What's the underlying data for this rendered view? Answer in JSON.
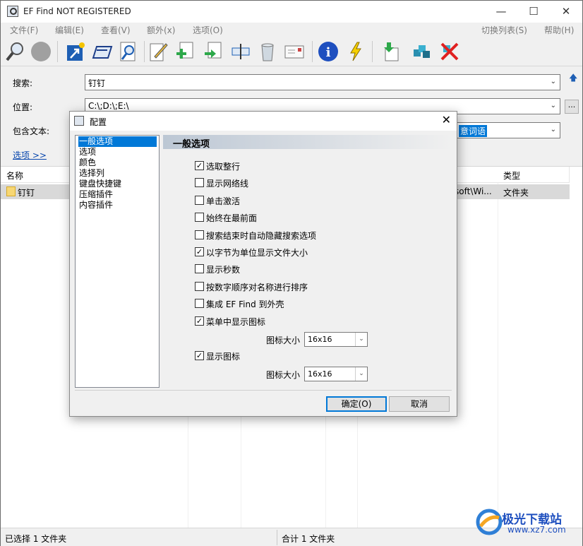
{
  "app": {
    "title": "EF Find NOT REGISTERED",
    "window_controls": {
      "minimize": "—",
      "maximize": "☐",
      "close": "✕"
    }
  },
  "menu": {
    "left": [
      "文件(F)",
      "编辑(E)",
      "查看(V)",
      "额外(x)",
      "选项(O)"
    ],
    "right": [
      "切换列表(S)",
      "帮助(H)"
    ]
  },
  "toolbar": {
    "icons": [
      "search-icon",
      "stop-icon",
      "open-folder-icon",
      "open-window-icon",
      "search-in-icon",
      "edit-icon",
      "copy-to-icon",
      "move-to-icon",
      "rename-icon",
      "recycle-bin-icon",
      "email-icon",
      "info-icon",
      "lightning-icon",
      "download-icon",
      "extract-icon",
      "delete-icon"
    ]
  },
  "search": {
    "search_label": "搜索:",
    "search_value": "钉钉",
    "location_label": "位置:",
    "location_value": "C:\\;D:\\;E:\\",
    "contains_label": "包含文本:",
    "contains_highlight": "意词语",
    "options_link": "选项 >>",
    "browse_label": "..."
  },
  "list": {
    "columns": [
      "名称",
      "类型"
    ],
    "rows": [
      {
        "name": "钉钉",
        "path_fragment": "soft\\Wi...",
        "type": "文件夹"
      }
    ]
  },
  "status": {
    "selected": "已选择 1 文件夹",
    "total": "合计 1 文件夹"
  },
  "dialog": {
    "title": "配置",
    "close": "✕",
    "tree": [
      "一般选项",
      "选项",
      "颜色",
      "选择列",
      "键盘快捷键",
      "压缩插件",
      "内容插件"
    ],
    "selected_tree_index": 0,
    "section_title": "一般选项",
    "options": [
      {
        "label": "选取整行",
        "checked": true
      },
      {
        "label": "显示网络线",
        "checked": false
      },
      {
        "label": "单击激活",
        "checked": false
      },
      {
        "label": "始终在最前面",
        "checked": false
      },
      {
        "label": "搜索结束时自动隐藏搜索选项",
        "checked": false
      },
      {
        "label": "以字节为单位显示文件大小",
        "checked": true
      },
      {
        "label": "显示秒数",
        "checked": false
      },
      {
        "label": "按数字顺序对名称进行排序",
        "checked": false
      },
      {
        "label": "集成 EF Find 到外壳",
        "checked": false
      },
      {
        "label": "菜单中显示图标",
        "checked": true
      }
    ],
    "menu_icon_size_label": "图标大小",
    "menu_icon_size_value": "16x16",
    "show_icons": {
      "label": "显示图标",
      "checked": true
    },
    "icon_size_label": "图标大小",
    "icon_size_value": "16x16",
    "ok_label": "确定(O)",
    "cancel_label": "取消"
  },
  "watermark": {
    "text": "极光下载站",
    "url": "www.xz7.com"
  }
}
